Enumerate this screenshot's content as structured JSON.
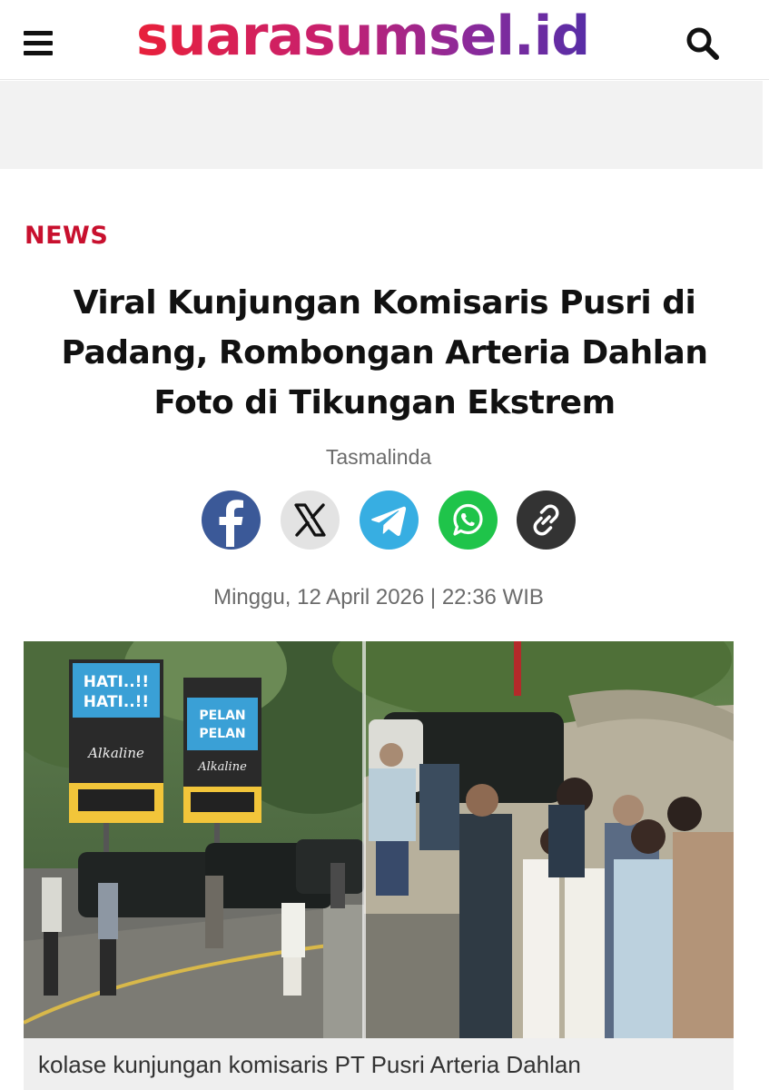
{
  "site": {
    "logo_text": "suarasumsel.id",
    "brand_gradient": [
      "#e8203a",
      "#c8206e",
      "#8c2a9a",
      "#4e2ea8"
    ]
  },
  "header": {
    "menu_icon": "hamburger-menu-icon",
    "search_icon": "search-icon"
  },
  "article": {
    "category": "NEWS",
    "category_color": "#c8102e",
    "title": "Viral Kunjungan Komisaris Pusri di Padang, Rombongan Arteria Dahlan Foto di Tikungan Ekstrem",
    "author": "Tasmalinda",
    "published": "Minggu, 12 April 2026 | 22:36 WIB",
    "image_caption": "kolase kunjungan komisaris PT Pusri Arteria Dahlan"
  },
  "share": [
    {
      "icon": "facebook-icon",
      "color": "#3b5998"
    },
    {
      "icon": "x-icon",
      "color": "#e3e3e3"
    },
    {
      "icon": "telegram-icon",
      "color": "#37aee2"
    },
    {
      "icon": "whatsapp-icon",
      "color": "#1fc44a"
    },
    {
      "icon": "link-icon",
      "color": "#333333"
    }
  ],
  "photo_signs": {
    "left_sign": "HATI..!! HATI..!!",
    "right_sign": "PELAN PELAN",
    "sponsor": "Alkaline"
  }
}
